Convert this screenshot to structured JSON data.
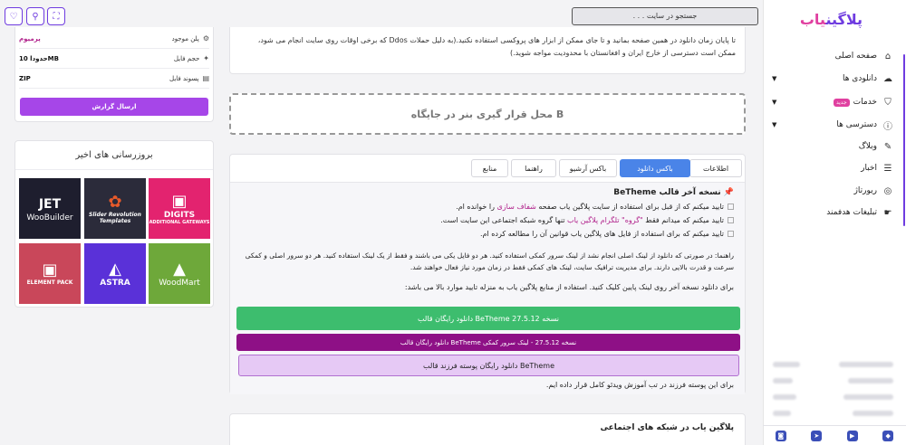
{
  "sidebar": {
    "logo_main": "پلاگین",
    "logo_accent": "یاب",
    "items": [
      {
        "label": "صفحه اصلی",
        "icon": "home-icon",
        "glyph": "⌂"
      },
      {
        "label": "دانلودی ها",
        "icon": "cloud-download-icon",
        "glyph": "☁",
        "caret": "▼"
      },
      {
        "label": "خدمات",
        "icon": "shield-icon",
        "glyph": "⛉",
        "badge": "جدید",
        "caret": "▼"
      },
      {
        "label": "دسترسی ها",
        "icon": "info-icon",
        "glyph": "ⓘ",
        "caret": "▼"
      },
      {
        "label": "وبلاگ",
        "icon": "blog-icon",
        "glyph": "✎"
      },
      {
        "label": "اخبار",
        "icon": "news-icon",
        "glyph": "☰"
      },
      {
        "label": "ریورتاژ",
        "icon": "report-icon",
        "glyph": "◎"
      },
      {
        "label": "تبلیغات هدفمند",
        "icon": "megaphone-icon",
        "glyph": "☛"
      }
    ]
  },
  "topbar": {
    "search_placeholder": "جستجو در سایت . . .",
    "btn1_glyph": "⛶",
    "btn2_glyph": "⚲",
    "btn3_glyph": "♡"
  },
  "product_info": {
    "rows": [
      {
        "label": "پلن موجود",
        "value": "پرمیوم",
        "icon": "plan-icon",
        "glyph": "⚙"
      },
      {
        "label": "حجم فایل",
        "value": "حدودا 10MB",
        "icon": "bulb-icon",
        "glyph": "💡"
      },
      {
        "label": "پسوند فایل",
        "value": "ZIP",
        "icon": "file-icon",
        "glyph": "▤"
      }
    ],
    "report_button": "ارسال گزارش"
  },
  "recent": {
    "title": "بروزرسانی های اخیر",
    "tiles": [
      {
        "label": "DIGITS",
        "sub": "ADDITIONAL GATEWAYS",
        "glyph": "▣",
        "bg": "#e3236f"
      },
      {
        "label": "Slider Revolution",
        "sub": "Templates",
        "glyph": "✿",
        "bg": "#2b2b3a"
      },
      {
        "label": "WooBuilder",
        "sub": "",
        "glyph": "JET",
        "bg": "#1e1e2e"
      },
      {
        "label": "WoodMart",
        "sub": "",
        "glyph": "▲",
        "bg": "#6ea83a"
      },
      {
        "label": "ASTRA",
        "sub": "",
        "glyph": "◭",
        "bg": "#5a31d8"
      },
      {
        "label": "ELEMENT PACK",
        "sub": "",
        "glyph": "▣",
        "bg": "#c9475a"
      }
    ]
  },
  "notice": {
    "text": "تا پایان زمان دانلود در همین صفحه بمانید و تا جای ممکن از ابزار های پروکسی استفاده نکنید.(به دلیل حملات Ddos که برخی اوقات روی سایت انجام می شود، ممکن است دسترسی از خارج ایران و افغانستان با محدودیت مواجه شوید.)"
  },
  "banner": {
    "text": "محل قرار گیری بنر در جایگاه B"
  },
  "tabs": [
    "اطلاعات",
    "باکس دانلود",
    "باکس آرشیو",
    "راهنما",
    "منابع"
  ],
  "download": {
    "title": "نسخه آخر قالب BeTheme",
    "check1_pre": "تایید میکنم که از قبل برای استفاده از سایت پلاگین یاب صفحه",
    "check1_link": "شفاف سازی",
    "check1_post": "را خوانده ام.",
    "check2_pre": "تایید میکنم که میدانم فقط",
    "check2_link": "\"گروه\" تلگرام پلاگین یاب",
    "check2_post": "تنها گروه شبکه اجتماعی این سایت است.",
    "check3": "تایید میکنم که برای استفاده از فایل های پلاگین یاب قوانین آن را مطالعه کرده ام.",
    "guide": "راهنما: در صورتی که دانلود از لینک اصلی انجام نشد از لینک سرور کمکی استفاده کنید. هر دو فایل یکی می باشند و فقط از یک لینک استفاده کنید. هر دو سرور اصلی و کمکی سرعت و قدرت بالایی دارند. برای مدیریت ترافیک سایت، لینک های کمکی فقط در زمان مورد نیاز فعال خواهند شد.",
    "instruction": "برای دانلود نسخه آخر روی لینک پایین کلیک کنید. استفاده از منابع پلاگین یاب به منزله تایید موارد بالا می باشد:",
    "btn_main": "دانلود رایگان قالب BeTheme نسخه 27.5.12",
    "btn_mirror": "دانلود رایگان قالب BeTheme نسخه 27.5.12 - لینک سرور کمکی",
    "btn_child": "دانلود رایگان پوسته فرزند قالب BeTheme",
    "child_note": "برای این پوسته فرزند در تب آموزش ویدئو کامل قرار داده ایم."
  },
  "social": {
    "title": "پلاگین یاب در شبکه های اجتماعی"
  },
  "colors": {
    "accent": "#6f3ce0",
    "green": "#3dbd6e",
    "magenta": "#8e1086",
    "lavender": "#e6c9f5"
  }
}
